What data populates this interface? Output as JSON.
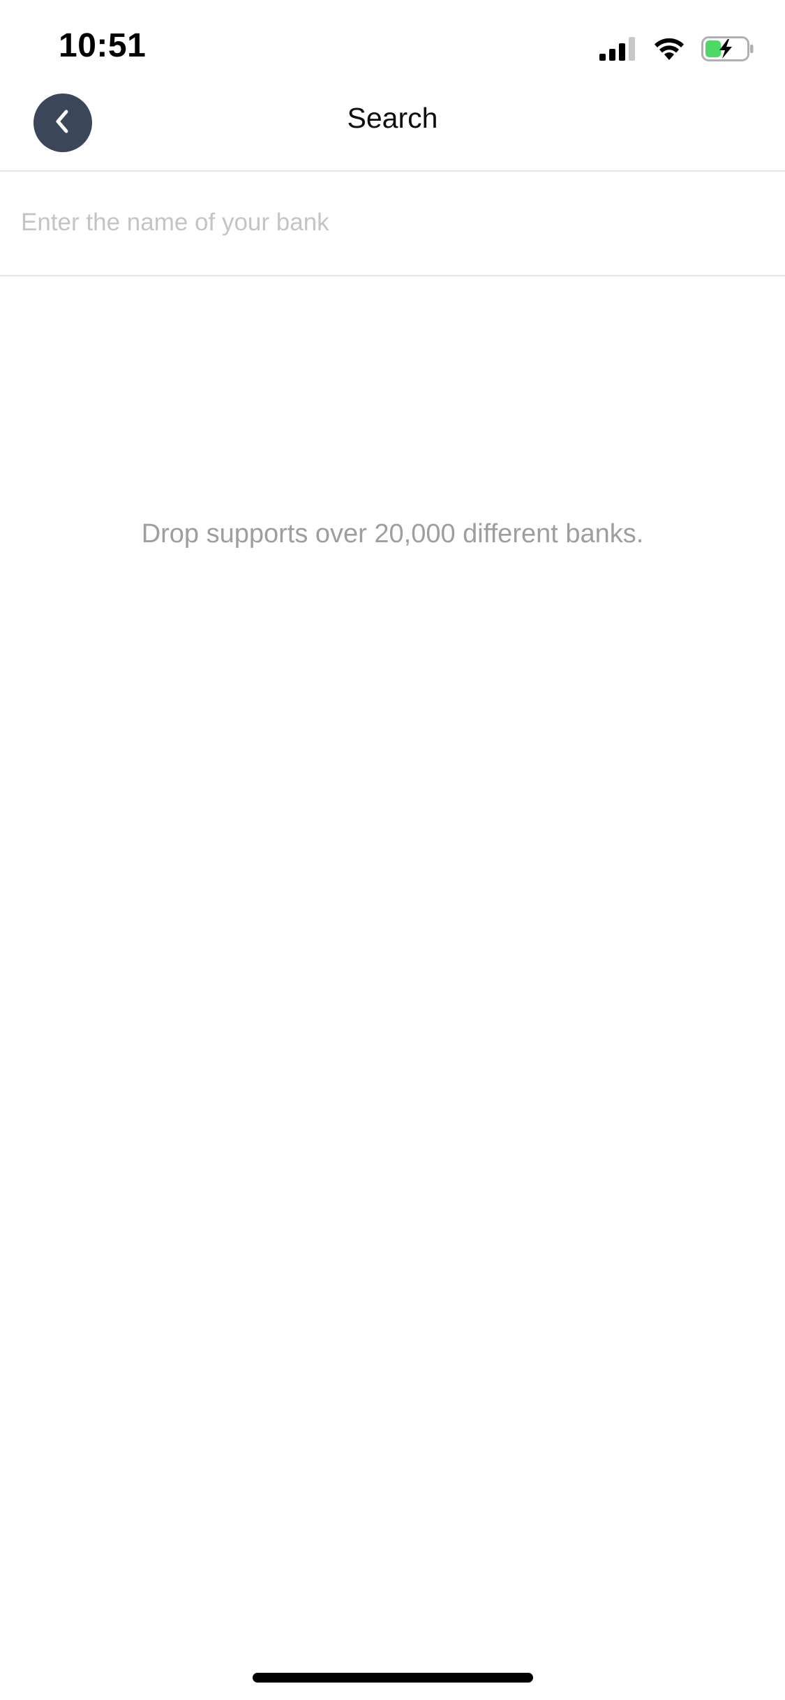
{
  "status_bar": {
    "time": "10:51",
    "icons": [
      "signal-icon",
      "wifi-icon",
      "battery-charging-icon"
    ],
    "battery_color": "#4cd964"
  },
  "nav": {
    "title": "Search",
    "back_icon": "chevron-left-icon",
    "back_button_color": "#3b4659"
  },
  "search": {
    "placeholder": "Enter the name of your bank",
    "value": ""
  },
  "empty_state": {
    "message": "Drop supports over 20,000 different banks."
  }
}
